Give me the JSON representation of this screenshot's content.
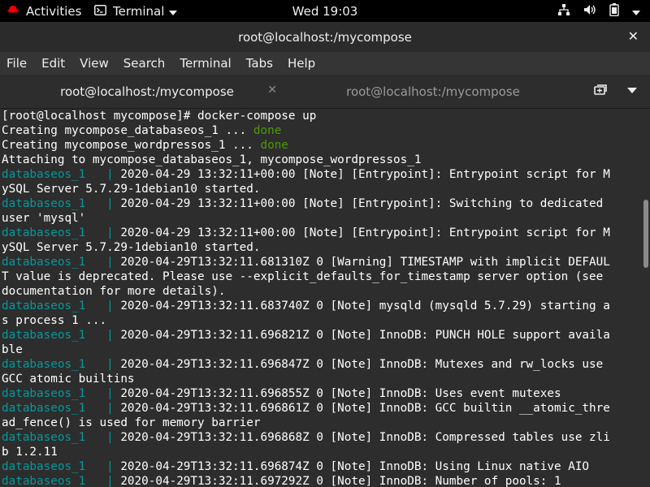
{
  "topbar": {
    "activities": "Activities",
    "app_name": "Terminal",
    "clock": "Wed 19:03"
  },
  "window": {
    "title": "root@localhost:/mycompose"
  },
  "menu": {
    "items": [
      "File",
      "Edit",
      "View",
      "Search",
      "Terminal",
      "Tabs",
      "Help"
    ]
  },
  "tabs": [
    {
      "label": "root@localhost:/mycompose",
      "active": true
    },
    {
      "label": "root@localhost:/mycompose",
      "active": false
    }
  ],
  "terminal": {
    "lines": [
      {
        "segments": [
          {
            "text": "[root@localhost mycompose]# docker-compose up"
          }
        ]
      },
      {
        "segments": [
          {
            "text": "Creating mycompose_databaseos_1 ... "
          },
          {
            "text": "done",
            "cls": "ok"
          }
        ]
      },
      {
        "segments": [
          {
            "text": "Creating mycompose_wordpressos_1 ... "
          },
          {
            "text": "done",
            "cls": "ok"
          }
        ]
      },
      {
        "segments": [
          {
            "text": "Attaching to mycompose_databaseos_1, mycompose_wordpressos_1"
          }
        ]
      },
      {
        "segments": [
          {
            "text": "databaseos_1   | ",
            "cls": "svc"
          },
          {
            "text": "2020-04-29 13:32:11+00:00 [Note] [Entrypoint]: Entrypoint script for M"
          }
        ]
      },
      {
        "segments": [
          {
            "text": "ySQL Server 5.7.29-1debian10 started."
          }
        ]
      },
      {
        "segments": [
          {
            "text": "databaseos_1   | ",
            "cls": "svc"
          },
          {
            "text": "2020-04-29 13:32:11+00:00 [Note] [Entrypoint]: Switching to dedicated"
          }
        ]
      },
      {
        "segments": [
          {
            "text": "user 'mysql'"
          }
        ]
      },
      {
        "segments": [
          {
            "text": "databaseos_1   | ",
            "cls": "svc"
          },
          {
            "text": "2020-04-29 13:32:11+00:00 [Note] [Entrypoint]: Entrypoint script for M"
          }
        ]
      },
      {
        "segments": [
          {
            "text": "ySQL Server 5.7.29-1debian10 started."
          }
        ]
      },
      {
        "segments": [
          {
            "text": "databaseos_1   | ",
            "cls": "svc"
          },
          {
            "text": "2020-04-29T13:32:11.681310Z 0 [Warning] TIMESTAMP with implicit DEFAUL"
          }
        ]
      },
      {
        "segments": [
          {
            "text": "T value is deprecated. Please use --explicit_defaults_for_timestamp server option (see"
          }
        ]
      },
      {
        "segments": [
          {
            "text": "documentation for more details)."
          }
        ]
      },
      {
        "segments": [
          {
            "text": "databaseos_1   | ",
            "cls": "svc"
          },
          {
            "text": "2020-04-29T13:32:11.683740Z 0 [Note] mysqld (mysqld 5.7.29) starting a"
          }
        ]
      },
      {
        "segments": [
          {
            "text": "s process 1 ..."
          }
        ]
      },
      {
        "segments": [
          {
            "text": "databaseos_1   | ",
            "cls": "svc"
          },
          {
            "text": "2020-04-29T13:32:11.696821Z 0 [Note] InnoDB: PUNCH HOLE support availa"
          }
        ]
      },
      {
        "segments": [
          {
            "text": "ble"
          }
        ]
      },
      {
        "segments": [
          {
            "text": "databaseos_1   | ",
            "cls": "svc"
          },
          {
            "text": "2020-04-29T13:32:11.696847Z 0 [Note] InnoDB: Mutexes and rw_locks use"
          }
        ]
      },
      {
        "segments": [
          {
            "text": "GCC atomic builtins"
          }
        ]
      },
      {
        "segments": [
          {
            "text": "databaseos_1   | ",
            "cls": "svc"
          },
          {
            "text": "2020-04-29T13:32:11.696855Z 0 [Note] InnoDB: Uses event mutexes"
          }
        ]
      },
      {
        "segments": [
          {
            "text": "databaseos_1   | ",
            "cls": "svc"
          },
          {
            "text": "2020-04-29T13:32:11.696861Z 0 [Note] InnoDB: GCC builtin __atomic_thre"
          }
        ]
      },
      {
        "segments": [
          {
            "text": "ad_fence() is used for memory barrier"
          }
        ]
      },
      {
        "segments": [
          {
            "text": "databaseos_1   | ",
            "cls": "svc"
          },
          {
            "text": "2020-04-29T13:32:11.696868Z 0 [Note] InnoDB: Compressed tables use zli"
          }
        ]
      },
      {
        "segments": [
          {
            "text": "b 1.2.11"
          }
        ]
      },
      {
        "segments": [
          {
            "text": "databaseos_1   | ",
            "cls": "svc"
          },
          {
            "text": "2020-04-29T13:32:11.696874Z 0 [Note] InnoDB: Using Linux native AIO"
          }
        ]
      },
      {
        "segments": [
          {
            "text": "databaseos_1   | ",
            "cls": "svc"
          },
          {
            "text": "2020-04-29T13:32:11.697292Z 0 [Note] InnoDB: Number of pools: 1"
          }
        ]
      }
    ]
  },
  "colors": {
    "service_prefix": "#06989a",
    "done": "#4e9a06",
    "text": "#ffffff",
    "background": "#2d2d2d"
  },
  "icons": [
    "redhat-icon",
    "terminal-app-icon",
    "network-icon",
    "volume-icon",
    "battery-icon",
    "new-tab-icon"
  ]
}
